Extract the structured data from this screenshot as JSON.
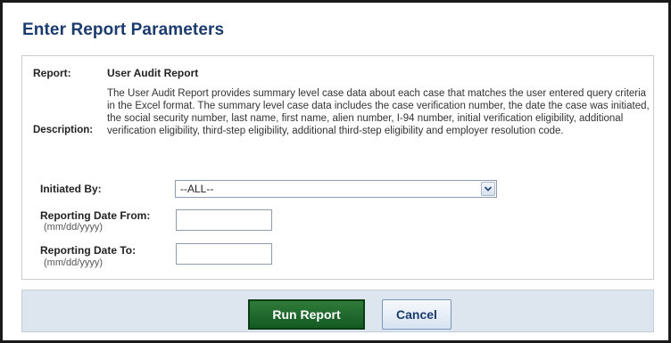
{
  "form": {
    "title": "Enter Report Parameters",
    "report_label": "Report:",
    "report_name": "User Audit Report",
    "description_label": "Description:",
    "description_text": "The User Audit Report provides summary level case data about each case that matches the user entered query criteria in the Excel format. The summary level case data includes the case verification number, the date the case was initiated, the social security number, last name, first name, alien number, I-94 number, initial verification eligibility, additional verification eligibility, third-step eligibility, additional third-step eligibility and employer resolution code.",
    "initiated_by": {
      "label": "Initiated By:",
      "selected_value": "--ALL--"
    },
    "date_from": {
      "label": "Reporting Date From:",
      "hint": "(mm/dd/yyyy)",
      "value": ""
    },
    "date_to": {
      "label": "Reporting Date To:",
      "hint": "(mm/dd/yyyy)",
      "value": ""
    }
  },
  "actions": {
    "run_label": "Run Report",
    "cancel_label": "Cancel"
  },
  "colors": {
    "title": "#1b3b6f",
    "run_button": "#1e6a2c",
    "footer_bg": "#dde6ef"
  },
  "icons": {
    "dropdown": "chevron-down-icon"
  }
}
